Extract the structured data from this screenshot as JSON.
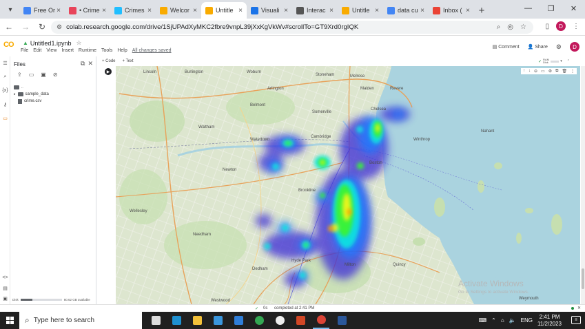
{
  "browser": {
    "tabs": [
      {
        "title": "Free Or",
        "favicon": "free-favicon",
        "color": "#4285f4",
        "active": false
      },
      {
        "title": "• Crime",
        "favicon": "crime-favicon",
        "color": "#e8445a",
        "active": false
      },
      {
        "title": "Crimes",
        "favicon": "kaggle-favicon",
        "color": "#20beff",
        "active": false
      },
      {
        "title": "Welcor",
        "favicon": "colab-favicon",
        "color": "#f9ab00",
        "active": false
      },
      {
        "title": "Untitle",
        "favicon": "colab-favicon",
        "color": "#f9ab00",
        "active": true
      },
      {
        "title": "Visuali",
        "favicon": "visualize-favicon",
        "color": "#1a73e8",
        "active": false
      },
      {
        "title": "Interac",
        "favicon": "interact-favicon",
        "color": "#555555",
        "active": false
      },
      {
        "title": "Untitle",
        "favicon": "colab-favicon",
        "color": "#f9ab00",
        "active": false
      },
      {
        "title": "data cu",
        "favicon": "google-favicon",
        "color": "#4285f4",
        "active": false
      },
      {
        "title": "Inbox (",
        "favicon": "gmail-favicon",
        "color": "#ea4335",
        "active": false
      }
    ],
    "url": "colab.research.google.com/drive/1SjUPAdXyMKC2fbre9vnpL39jXxKgVkWv#scrollTo=GT9Xrd0rgIQK",
    "profile_initial": "D"
  },
  "colab": {
    "logo": "CO",
    "notebook_title": "Untitled1.ipynb",
    "menu": [
      "File",
      "Edit",
      "View",
      "Insert",
      "Runtime",
      "Tools",
      "Help"
    ],
    "save_status": "All changes saved",
    "comment": "Comment",
    "share": "Share",
    "profile_initial": "D",
    "add_code": "+ Code",
    "add_text": "+ Text",
    "ram_label": "RAM",
    "disk_label": "Disk"
  },
  "files_panel": {
    "title": "Files",
    "items": [
      {
        "name": "sample_data",
        "type": "folder"
      },
      {
        "name": "crime.csv",
        "type": "file"
      }
    ],
    "disk_label": "Disk",
    "disk_available": "80.62 GB available",
    "disk_used_fraction": 0.28
  },
  "map": {
    "labels": [
      "Lincoln",
      "Burlington",
      "Woburn",
      "Stoneham",
      "Malden",
      "Revere",
      "Melrose",
      "Somerville",
      "Chelsea",
      "Waltham",
      "Belmont",
      "Arlington",
      "Cambridge",
      "Watertown",
      "Newton",
      "Boston",
      "Brookline",
      "Winthrop",
      "Needham",
      "Dedham",
      "Milton",
      "Quincy",
      "Wellesley",
      "Hyde Park",
      "Weymouth",
      "Westwood",
      "Nahant"
    ],
    "heat_colors": [
      "#3b2bd6",
      "#1f7cff",
      "#11e6e0",
      "#38f23a",
      "#e7f51a",
      "#ff9a00"
    ]
  },
  "watermark": {
    "title": "Activate Windows",
    "subtitle": "Go to Settings to activate Windows."
  },
  "status": {
    "check": "✓",
    "elapsed": "0s",
    "message": "completed at 2:41 PM"
  },
  "taskbar": {
    "search_placeholder": "Type here to search",
    "apps": [
      {
        "name": "task-view",
        "color": "#dddddd"
      },
      {
        "name": "edge",
        "color": "#1e90d0"
      },
      {
        "name": "file-explorer",
        "color": "#f3c13a"
      },
      {
        "name": "store",
        "color": "#3a96dd"
      },
      {
        "name": "mail",
        "color": "#2f7ed8"
      },
      {
        "name": "chrome",
        "color": "#34a853"
      },
      {
        "name": "chrome-profile",
        "color": "#eeeeee"
      },
      {
        "name": "powerpoint",
        "color": "#d24726"
      },
      {
        "name": "chrome-active",
        "color": "#db4437"
      },
      {
        "name": "word",
        "color": "#2b579a"
      }
    ],
    "language": "ENG",
    "time": "2:41 PM",
    "date": "11/2/2023"
  }
}
